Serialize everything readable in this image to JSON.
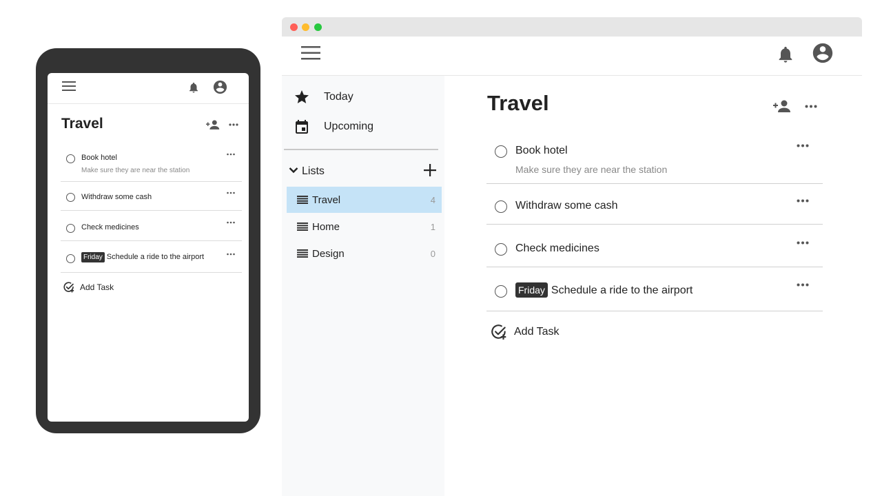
{
  "colors": {
    "phone_body": "#333333",
    "sidebar_bg": "#f8f9fa",
    "active_list_bg": "#c5e3f7",
    "tag_bg": "#333333",
    "window_chrome": "#e6e6e6"
  },
  "icons": {
    "menu": "hamburger-menu-icon",
    "bell": "bell-icon",
    "account": "account-circle-icon",
    "today": "star-icon",
    "upcoming": "calendar-icon",
    "lists_toggle": "chevron-down-icon",
    "add_list": "plus-icon",
    "list": "list-lines-icon",
    "add_person": "add-person-icon",
    "more": "more-horizontal-icon",
    "add_task": "add-task-check-icon"
  },
  "phone": {
    "list_title": "Travel",
    "tasks": [
      {
        "title": "Book hotel",
        "note": "Make sure they are near the station"
      },
      {
        "title": "Withdraw some cash"
      },
      {
        "title": "Check medicines"
      },
      {
        "tag": "Friday",
        "title": "Schedule a ride to the airport"
      }
    ],
    "add_task_label": "Add Task"
  },
  "desktop": {
    "sidebar": {
      "nav": [
        {
          "label": "Today"
        },
        {
          "label": "Upcoming"
        }
      ],
      "lists_label": "Lists",
      "lists": [
        {
          "name": "Travel",
          "count": "4",
          "active": true
        },
        {
          "name": "Home",
          "count": "1",
          "active": false
        },
        {
          "name": "Design",
          "count": "0",
          "active": false
        }
      ]
    },
    "main": {
      "list_title": "Travel",
      "tasks": [
        {
          "title": "Book hotel",
          "note": "Make sure they are near the station"
        },
        {
          "title": "Withdraw some cash"
        },
        {
          "title": "Check medicines"
        },
        {
          "tag": "Friday",
          "title": "Schedule a ride to the airport"
        }
      ],
      "add_task_label": "Add Task"
    }
  }
}
